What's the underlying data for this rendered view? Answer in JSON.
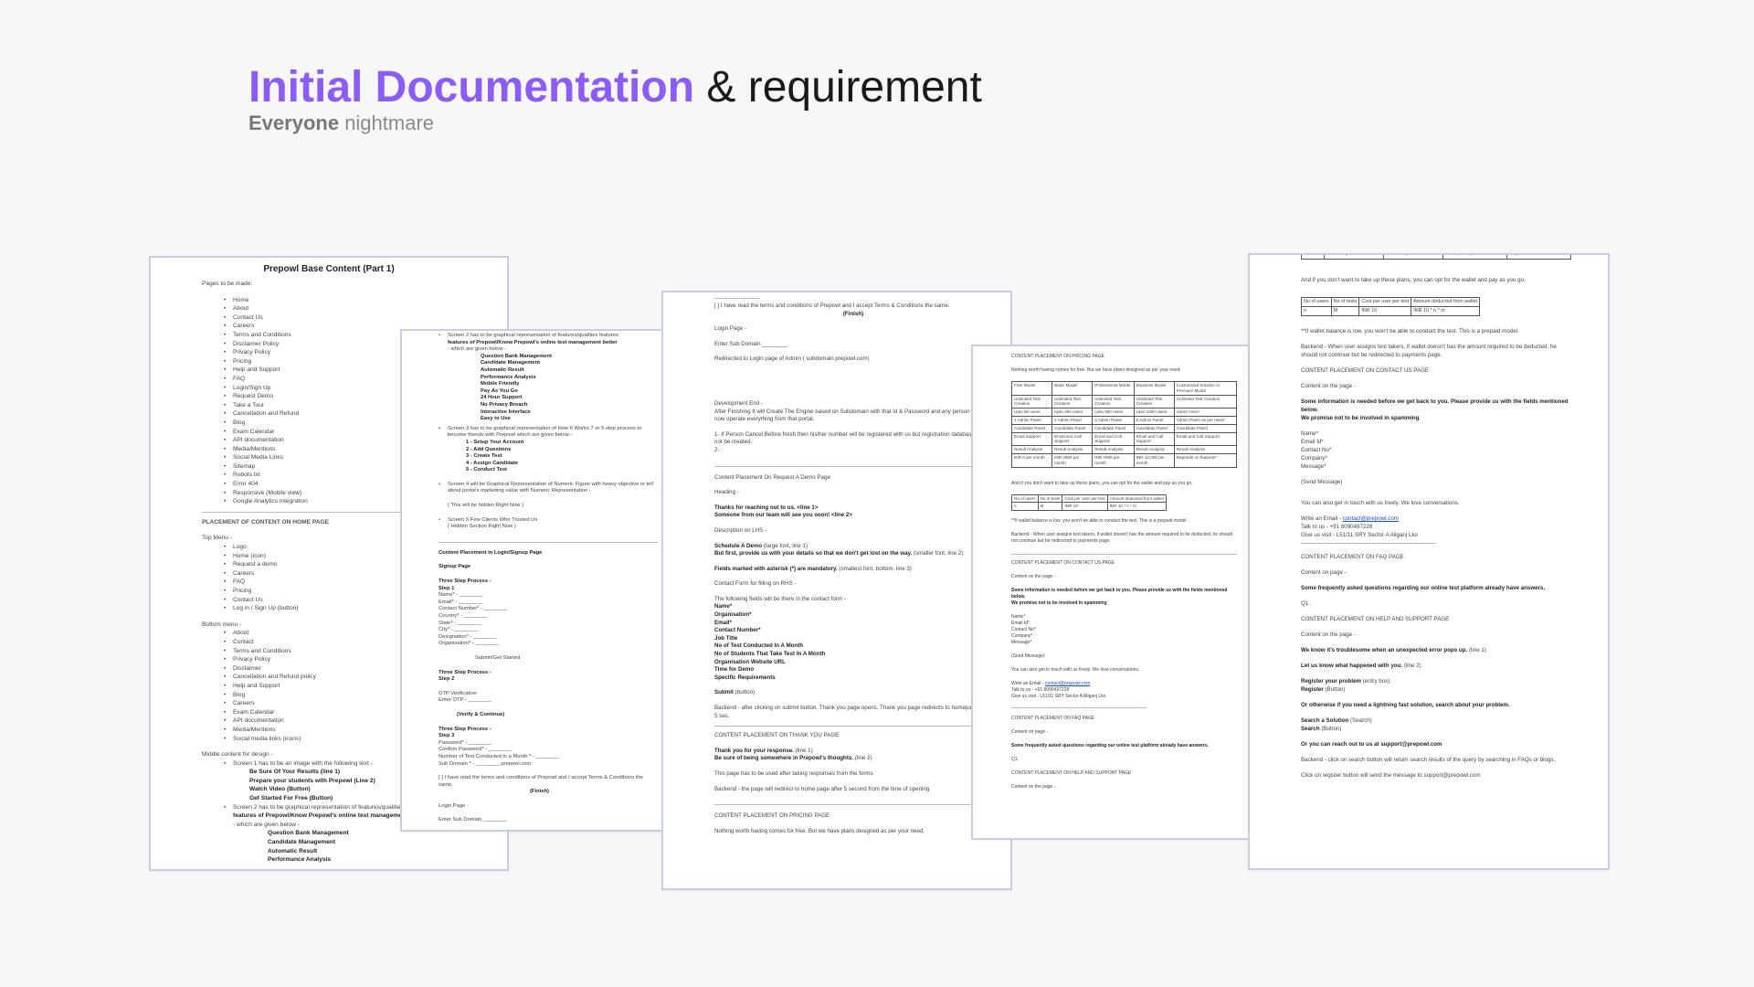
{
  "heading": {
    "highlight": "Initial Documentation",
    "rest": "& requirement"
  },
  "subheading": {
    "bold": "Everyone",
    "rest": "nightmare"
  },
  "doc1": {
    "title": "Prepowl Base Content (Part 1)",
    "pages_label": "Pages to be made:",
    "pages": [
      "Home",
      "About",
      "Contact Us",
      "Careers",
      "Terms and Conditions",
      "Disclaimer Policy",
      "Privacy Policy",
      "Pricing",
      "Help and Support",
      "FAQ",
      "Login/Sign Up",
      "Request Demo",
      "Take a Tour",
      "Cancellation and Refund",
      "Blog",
      "Exam Calendar",
      "API documentation",
      "Media/Mentions",
      "Social Media Links",
      "Sitemap",
      "Robots.txt",
      "Error 404",
      "Responsive (Mobile view)",
      "Google Analytics integration"
    ],
    "placement_heading": "PLACEMENT OF CONTENT ON HOME PAGE",
    "top_menu_label": "Top Menu -",
    "top_menu": [
      "Logo",
      "Home (icon)",
      "Request a demo",
      "Careers",
      "FAQ",
      "Pricing",
      "Contact Us",
      "Log in / Sign Up (button)"
    ],
    "bottom_menu_label": "Bottom menu -",
    "bottom_menu": [
      "About",
      "Contact",
      "Terms and Conditions",
      "Privacy Policy",
      "Disclaimer",
      "Cancellation and Refund policy",
      "Help and Support",
      "Blog",
      "Careers",
      "Exam Calendar",
      "API documentation",
      "Media/Mentions",
      "Social media links (icons)"
    ],
    "middle_label": "Middle content for design -",
    "middle": [
      "Screen 1 has to be an image with the following text -",
      "Be Sure Of Your Results (line 1)",
      "Prepare your students with Prepowl (Line 2)",
      "Watch Video (Button)",
      "Get Started For Free (Button)",
      "Screen 2 has to be graphical representation of features/qualities",
      "features of Prepowl/Know Prepowl's online test management",
      "- which are given below -",
      "Question Bank Management",
      "Candidate Management",
      "Automatic Result",
      "Performance Analysis"
    ]
  },
  "doc2": {
    "top": [
      "Screen 2 has to be graphical representation of features/qualities features",
      "features of Prepowl/Know Prepowl's online test management better",
      "- which are given below -"
    ],
    "features": [
      "Question Bank Management",
      "Candidate Management",
      "Automatic Result",
      "Performance Analysis",
      "Mobile Friendly",
      "Pay As You Go",
      "24 Hour Support",
      "No Privacy Breach",
      "Interactive Interface",
      "Easy to Use"
    ],
    "screen3": "Screen 3 has to be graphical representation of How It Works 7 or 5 step process to become friends with Prepowl which are given below -",
    "steps": [
      "1 - Setup Your Account",
      "2 - Add Questions",
      "3 - Create Test",
      "4 - Assign Candidate",
      "5 - Conduct Test"
    ],
    "screen4": "Screen 4 will be Graphical Representation of Numeric Figure with heavy objective to tell about portal's marketing value with Numeric Representation -",
    "screen4_note": "( This will be hidden Right Now )",
    "screen5": "Screen 5 Few Clients Who Trusted Us",
    "screen5_note": "( Hidden Section Right Now )",
    "login_heading": "Content Placement in Login/Signup Page",
    "signup": "Signup Page",
    "step1_title": "Three Step Process -",
    "step1": "Step 1",
    "fields1": [
      "Name* - ________",
      "Email* - ________",
      "Contact Number* - ________",
      "Country* - ________",
      "State* - ________",
      "City* - ________",
      "Designation* - ________",
      "Organisation* - ________"
    ],
    "get_started": "Submit/Get Started",
    "step2_title": "Three Step Process -",
    "step2": "Step 2",
    "step2_lines": [
      "OTP Verification",
      "Enter OTP - ________"
    ],
    "verify": "(Verify & Continue)",
    "step3_title": "Three Step Process -",
    "step3": "Step 3",
    "fields3": [
      "Password* - ________",
      "Confirm Password* - ________",
      "Number of Test Conducted in a Month * - ________",
      "Sub Domain * - ________.prepowl.com"
    ],
    "terms": "[ ] I have read the terms and conditions of Prepowl and I accept Terms & Conditions the same.",
    "finish": "(Finish)",
    "login_page": "Login Page -",
    "enter_sub": "Enter Sub Domain ________"
  },
  "doc3": {
    "terms": "[ ] I have read the terms and conditions of Prepowl and I accept Terms & Conditions the same.",
    "finish": "(Finish)",
    "login_page": "Login Page -",
    "enter_sub": "Enter Sub Domain ________",
    "redirect": "Redirected to Login page of Admin ( subdomain.prepowl.com)",
    "dev_end": "Development End -",
    "dev_text": "After Finishing It will Create The Engine based on Subdomain with that Id & Password and any person can now operate everything from that portal.",
    "dev_note": "1- If Person Cancel Before finish then his/her number will be registered with us but registration database will not be created.",
    "dev_num": "2-",
    "demo_heading": "Content Placement On Request A Demo Page",
    "heading_label": "Heading -",
    "thanks1": "Thanks for reaching out to us. <line 1>",
    "thanks2": "Someone from our team will see you soon! <line 2>",
    "desc_label": "Description on LHS -",
    "schedule": "Schedule A Demo",
    "schedule_note": "(large font, line 1)",
    "but_first": "But first, provide us with your details so that we don't get lost on the way.",
    "but_first_note": "(smaller font, line 2)",
    "mandatory": "Fields marked with asterisk (*) are mandatory.",
    "mandatory_note": "(smallest font, bottom, line 3)",
    "form_label": "Contact Form for filling on RHS -",
    "form_intro": "The following fields will be there in the contact form -",
    "form_fields": [
      "Name*",
      "Organisation*",
      "Email*",
      "Contact Number*",
      "Job Title",
      "No of Test Conducted In A Month",
      "No of Students That Take Test In A Month",
      "Organisation Website URL",
      "Time for Demo",
      "Specific Requirements"
    ],
    "specific_note": "(message box)",
    "submit": "Submit",
    "submit_note": "(button)",
    "backend": "Backend - after clicking on submit button, Thank you page opens. Thank you page redirects to homepage after 5 sec.",
    "thank_heading": "CONTENT PLACEMENT ON THANK YOU PAGE",
    "thank1": "Thank you for your response.",
    "thank1_note": "(line 1)",
    "thank2": "Be sure of being somewhere in Prepowl's thoughts.",
    "thank2_note": "(line 2)",
    "thank_page_note": "This page has to be used after taking responses from the forms",
    "thank_backend": "Backend - the page will redirect to home page after 5 second from the time of opening",
    "pricing_heading": "CONTENT PLACEMENT ON PRICING PAGE",
    "pricing_text": "Nothing worth having comes for free. But we have plans designed as per your need."
  },
  "doc4": {
    "pricing_heading": "CONTENT PLACEMENT ON PRICING PAGE",
    "pricing_text": "Nothing worth having comes for free. But we have plans designed as per your need.",
    "plans": [
      [
        "Free Model",
        "Basic Model",
        "Professional Model",
        "Business Model",
        "Customized Solution or Premium Model"
      ],
      [
        "Unlimited Test Creation",
        "Unlimited Test Creation",
        "Unlimited Test Creation",
        "Unlimited Test Creation",
        "Unlimited Test Creation"
      ],
      [
        "Upto 50 users",
        "Upto 200 users",
        "Upto 500 users",
        "Upto 1000 users",
        "Users more*"
      ],
      [
        "1 Admin Panel",
        "2 Admin Panel",
        "3 Admin Panel",
        "5 Admin Panel",
        "Admin Panel as per need*"
      ],
      [
        "Candidate Panel",
        "Candidate Panel",
        "Candidate Panel",
        "Candidate Panel",
        "Candidate Panel"
      ],
      [
        "Email Support",
        "Email and Call Support",
        "Email and Call Support",
        "Email and Call Support",
        "Email and Call Support"
      ],
      [
        "Result Analysis",
        "Result Analysis",
        "Result Analysis",
        "Result Analysis",
        "Result Analysis"
      ],
      [
        "INR 0 per month",
        "INR 2500 per month",
        "INR 7500 per month",
        "INR 12,000 per month",
        "Depends on features*"
      ]
    ],
    "wallet_text": "And if you don't want to take up these plans, you can opt for the wallet and pay as you go.",
    "wallet_table": [
      [
        "No of users",
        "No of tests",
        "Cost per user per test",
        "Amount deducted from wallet"
      ],
      [
        "n",
        "M",
        "INR 10",
        "INR 10 * n * m"
      ]
    ],
    "wallet_note": "**If wallet balance is low, you won't be able to conduct the test. This is a prepaid model.",
    "wallet_backend": "Backend - When user assigns test takers, if wallet doesn't has the amount required to be deducted, he should not continue but be redirected to payments page.",
    "contact_heading": "CONTENT PLACEMENT ON CONTACT US PAGE",
    "contact_label": "Content on the page -",
    "contact_bold": "Some information is needed before we get back to you. Please provide us with the fields mentioned below.",
    "contact_bold2": "We promise not to be involved in spamming",
    "contact_fields": [
      "Name*",
      "Email Id*",
      "Contact No*",
      "Company*",
      "Message*"
    ],
    "send": "(Send Message)",
    "touch": "You can also get in touch with us freely. We love conversations.",
    "write_label": "Write an Email -",
    "email": "contact@prepowl.com",
    "talk": "Talk to us - +91 8090497228",
    "visit": "Give us visit - L51/11 SRY Sector A Aliganj Lko",
    "faq_heading": "CONTENT PLACEMENT ON FAQ PAGE",
    "faq_label": "Content on page -",
    "faq_bold": "Some frequently asked questions regarding our online test platform already have answers.",
    "q1": "Q1.",
    "help_heading": "CONTENT PLACEMENT ON HELP AND SUPPORT PAGE",
    "help_label": "Content on the page -"
  },
  "doc5": {
    "top_row": [
      "month",
      "INR 2500 per month",
      "INR 7500 per month",
      "INR 12,000 per month",
      "Depends on features*"
    ],
    "wallet_text": "And if you don't want to take up these plans, you can opt for the wallet and pay as you go.",
    "wallet_table": [
      [
        "No of users",
        "No of tests",
        "Cost per user per test",
        "Amount deducted from wallet"
      ],
      [
        "n",
        "M",
        "INR 10",
        "INR 10 * n * m"
      ]
    ],
    "wallet_note": "**If wallet balance is low, you won't be able to conduct the test. This is a prepaid model.",
    "wallet_backend": "Backend - When user assigns test takers, if wallet doesn't has the amount required to be deducted, he should not continue but be redirected to payments page.",
    "contact_heading": "CONTENT PLACEMENT ON CONTACT US PAGE",
    "contact_label": "Content on the page -",
    "contact_bold": "Some information is needed before we get back to you. Please provide us with the fields mentioned below.",
    "contact_bold2": "We promise not to be involved in spamming",
    "contact_fields": [
      "Name*",
      "Email Id*",
      "Contact No*",
      "Company*",
      "Message*"
    ],
    "send": "(Send Message)",
    "touch": "You can also get in touch with us freely. We love conversations.",
    "write_label": "Write an Email -",
    "email": "contact@prepowl.com",
    "talk": "Talk to us - +91 8090497228",
    "visit": "Give us visit - L51/11 SRY Sector A Aliganj Lko",
    "faq_heading": "CONTENT PLACEMENT ON FAQ PAGE",
    "faq_label": "Content on page -",
    "faq_bold": "Some frequently asked questions regarding our online test platform already have answers.",
    "q1": "Q1.",
    "help_heading": "CONTENT PLACEMENT ON HELP AND SUPPORT PAGE",
    "help_label": "Content on the page -",
    "help1": "We know it's troublesome when an unexpected error pops up.",
    "help1_note": "(line 1)",
    "help2": "Let us know what happened with you.",
    "help2_note": "(line 2)",
    "register1": "Register your problem",
    "register1_note": "(entry box)",
    "register2": "Register",
    "register2_note": "(Button)",
    "otherwise": "Or otherwise if you need a lightning fast solution, search about your problem.",
    "search1": "Search a Solution",
    "search1_note": "(Search)",
    "search2": "Search",
    "search2_note": "(Button)",
    "reach": "Or you can reach out to us at support@prepowl.com",
    "search_backend": "Backend - click on search button will return search results of the query by searching in FAQs or blogs.",
    "register_backend": "Click on register button will send the message to support@prepowl.com"
  }
}
